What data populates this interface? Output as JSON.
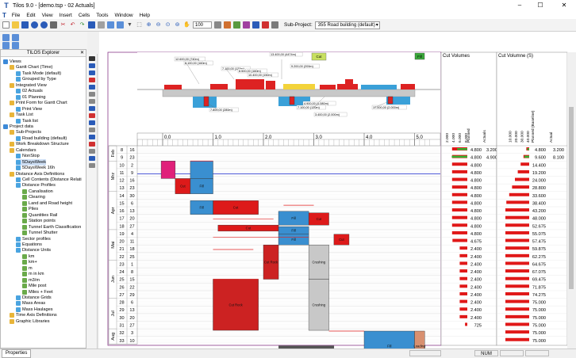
{
  "window": {
    "title": "Tilos 9.0  - [demo.tsp - 02 Actuals]",
    "min": "–",
    "max": "☐",
    "close": "✕"
  },
  "menu": {
    "file": "File",
    "edit": "Edit",
    "view": "View",
    "insert": "Insert",
    "cells": "Cells",
    "tools": "Tools",
    "window": "Window",
    "help": "Help"
  },
  "toolbar": {
    "zoom": "100",
    "subproject_label": "Sub-Project:",
    "subproject_value": "355 Road building (default)"
  },
  "explorer": {
    "title": "TILOS Explorer",
    "nodes": [
      {
        "label": "Views",
        "depth": 0
      },
      {
        "label": "Gantt Chart (Time)",
        "depth": 1
      },
      {
        "label": "Task Mode (default)",
        "depth": 2
      },
      {
        "label": "Grouped by Type",
        "depth": 2
      },
      {
        "label": "Integrated View",
        "depth": 1
      },
      {
        "label": "02 Actuals",
        "depth": 2
      },
      {
        "label": "01 Planning",
        "depth": 2
      },
      {
        "label": "Print Form for Gantt Chart",
        "depth": 1
      },
      {
        "label": "Print View",
        "depth": 2
      },
      {
        "label": "Task List",
        "depth": 1
      },
      {
        "label": "Task list",
        "depth": 2
      },
      {
        "label": "Project data",
        "depth": 0
      },
      {
        "label": "Sub-Projects",
        "depth": 1
      },
      {
        "label": "Road building (default)",
        "depth": 2
      },
      {
        "label": "Work Breakdown Structure",
        "depth": 1
      },
      {
        "label": "Calendars",
        "depth": 1
      },
      {
        "label": "NonStop",
        "depth": 2
      },
      {
        "label": "5DaysWeek",
        "depth": 2
      },
      {
        "label": "5DaysWeek 16h",
        "depth": 2
      },
      {
        "label": "Distance Axis Definitions",
        "depth": 1
      },
      {
        "label": "Cell Contents (Distance Relati",
        "depth": 2
      },
      {
        "label": "Distance Profiles",
        "depth": 2
      },
      {
        "label": "Canalisation",
        "depth": 3
      },
      {
        "label": "Clearing",
        "depth": 3
      },
      {
        "label": "Land and Road height",
        "depth": 3
      },
      {
        "label": "Piles",
        "depth": 3
      },
      {
        "label": "Quantities Rail",
        "depth": 3
      },
      {
        "label": "Station points",
        "depth": 3
      },
      {
        "label": "Tunnel Earth Classification",
        "depth": 3
      },
      {
        "label": "Tunnel Shutter",
        "depth": 3
      },
      {
        "label": "Sector profiles",
        "depth": 2
      },
      {
        "label": "Equations",
        "depth": 2
      },
      {
        "label": "Distance Units",
        "depth": 2
      },
      {
        "label": "km",
        "depth": 3
      },
      {
        "label": "km+",
        "depth": 3
      },
      {
        "label": "m",
        "depth": 3
      },
      {
        "label": "m in km",
        "depth": 3
      },
      {
        "label": "m3/m",
        "depth": 3
      },
      {
        "label": "Mile post",
        "depth": 3
      },
      {
        "label": "Miles + Feet",
        "depth": 3
      },
      {
        "label": "Distance Grids",
        "depth": 2
      },
      {
        "label": "Mass Areas",
        "depth": 2
      },
      {
        "label": "Mass Haulages",
        "depth": 2
      },
      {
        "label": "Time Axis Definitions",
        "depth": 1
      },
      {
        "label": "Graphic Libraries",
        "depth": 1
      }
    ]
  },
  "chart": {
    "distance_ticks": [
      "0.0",
      "1.0",
      "2.0",
      "3.0",
      "4.0",
      "5.0"
    ],
    "months": [
      {
        "label": "Feb",
        "row": 0,
        "span": 2
      },
      {
        "label": "Mrz",
        "row": 2,
        "span": 4
      },
      {
        "label": "Apr",
        "row": 6,
        "span": 5
      },
      {
        "label": "Mai",
        "row": 11,
        "span": 4
      },
      {
        "label": "Jun",
        "row": 15,
        "span": 5
      },
      {
        "label": "Jul",
        "row": 20,
        "span": 4
      },
      {
        "label": "Aug",
        "row": 24,
        "span": 2
      }
    ],
    "weeks": [
      {
        "w": "8",
        "d": "16"
      },
      {
        "w": "9",
        "d": "23"
      },
      {
        "w": "10",
        "d": "2"
      },
      {
        "w": "11",
        "d": "9"
      },
      {
        "w": "12",
        "d": "16"
      },
      {
        "w": "13",
        "d": "23"
      },
      {
        "w": "14",
        "d": "30"
      },
      {
        "w": "15",
        "d": "6"
      },
      {
        "w": "16",
        "d": "13"
      },
      {
        "w": "17",
        "d": "20"
      },
      {
        "w": "18",
        "d": "27"
      },
      {
        "w": "19",
        "d": "4"
      },
      {
        "w": "20",
        "d": "11"
      },
      {
        "w": "21",
        "d": "18"
      },
      {
        "w": "22",
        "d": "25"
      },
      {
        "w": "23",
        "d": "1"
      },
      {
        "w": "24",
        "d": "8"
      },
      {
        "w": "25",
        "d": "15"
      },
      {
        "w": "26",
        "d": "22"
      },
      {
        "w": "27",
        "d": "29"
      },
      {
        "w": "28",
        "d": "6"
      },
      {
        "w": "29",
        "d": "13"
      },
      {
        "w": "30",
        "d": "20"
      },
      {
        "w": "31",
        "d": "27"
      },
      {
        "w": "32",
        "d": "3"
      },
      {
        "w": "33",
        "d": "10"
      }
    ],
    "tasks": [
      {
        "label": "",
        "x0": -0.03,
        "x1": 0.25,
        "r0": 2.0,
        "r1": 4.3,
        "color": "#e0207a"
      },
      {
        "label": "",
        "x0": 0.55,
        "x1": 1.0,
        "r0": 2.0,
        "r1": 4.3,
        "color": "#3a8fd0"
      },
      {
        "label": "Cut",
        "x0": 0.25,
        "x1": 0.55,
        "r0": 4.3,
        "r1": 6.3,
        "color": "#dd1a1a"
      },
      {
        "label": "Fill",
        "x0": 0.55,
        "x1": 1.0,
        "r0": 4.3,
        "r1": 6.3,
        "color": "#3a8fd0"
      },
      {
        "label": "Cut",
        "x0": 1.0,
        "x1": 1.9,
        "r0": 7.2,
        "r1": 9.0,
        "color": "#dd1a1a"
      },
      {
        "label": "Fill",
        "x0": 0.55,
        "x1": 1.0,
        "r0": 7.2,
        "r1": 9.0,
        "color": "#3a8fd0"
      },
      {
        "label": "Fill",
        "x0": 2.3,
        "x1": 2.9,
        "r0": 8.6,
        "r1": 10.4,
        "color": "#3a8fd0"
      },
      {
        "label": "Cut",
        "x0": 2.9,
        "x1": 3.3,
        "r0": 8.8,
        "r1": 10.4,
        "color": "#dd1a1a"
      },
      {
        "label": "Cut",
        "x0": 1.1,
        "x1": 2.3,
        "r0": 10.4,
        "r1": 11.2,
        "color": "#dd1a1a"
      },
      {
        "label": "Fill",
        "x0": 2.3,
        "x1": 2.9,
        "r0": 10.6,
        "r1": 11.6,
        "color": "#3a8fd0"
      },
      {
        "label": "Fill",
        "x0": 2.3,
        "x1": 2.9,
        "r0": 11.6,
        "r1": 13.0,
        "color": "#3a8fd0"
      },
      {
        "label": "Cut",
        "x0": 3.4,
        "x1": 3.7,
        "r0": 11.6,
        "r1": 13.0,
        "color": "#dd1a1a"
      },
      {
        "label": "Cut Rock",
        "x0": 2.0,
        "x1": 2.3,
        "r0": 13.0,
        "r1": 17.5,
        "color": "#cc2222"
      },
      {
        "label": "Crushing",
        "x0": 2.9,
        "x1": 3.3,
        "r0": 13.0,
        "r1": 17.5,
        "color": "#c8c8c8"
      },
      {
        "label": "Cut Rock",
        "x0": 1.0,
        "x1": 1.9,
        "r0": 17.5,
        "r1": 24.2,
        "color": "#cc2222"
      },
      {
        "label": "Crushing",
        "x0": 2.9,
        "x1": 3.3,
        "r0": 17.5,
        "r1": 24.2,
        "color": "#c8c8c8"
      },
      {
        "label": "Fill",
        "x0": 4.0,
        "x1": 5.0,
        "r0": 24.3,
        "r1": 28.2,
        "color": "#3a8fd0"
      },
      {
        "label": "Loading",
        "x0": 5.0,
        "x1": 5.2,
        "r0": 24.3,
        "r1": 28.2,
        "color": "#d89070"
      }
    ],
    "long_section": {
      "blocks": [
        "#dd2222",
        "#f3d33a",
        "#3aa0d8",
        "#8cc83c"
      ],
      "labels": [
        "12.600,00 (740m)",
        "8.100,00 (160m)",
        "13.400,00 (4474m)",
        "7.100,00 (120m)",
        "8.500,00 (160m)",
        "10.400,00 (150m)",
        "9.200,00 (200m)",
        "7.800,00 (280m)",
        "3.400,00 (2.000m)",
        "4.900,00 (1.080m)",
        "7.100,00 (120m)",
        "17.000,00 (2.000m)"
      ],
      "callouts": [
        "Fill",
        "Cut"
      ]
    },
    "cut_volumes": {
      "header": "Cut Volumes",
      "axis": [
        "2.000",
        "4.000",
        "6.000",
        "8.000"
      ],
      "col_planned": "Planned",
      "col_actuals": "Actuals",
      "planned": [
        "4.800",
        "4.800",
        "4.800",
        "4.800",
        "4.800",
        "4.800",
        "4.800",
        "4.800",
        "4.800",
        "4.800",
        "4.800",
        "4.800",
        "4.675",
        "2.400",
        "2.400",
        "2.400",
        "2.400",
        "2.400",
        "2.400",
        "2.400",
        "2.400",
        "2.400",
        "2.400",
        "725",
        "",
        ""
      ],
      "actuals": [
        "3.200",
        "4.900",
        "",
        "",
        "",
        "",
        "",
        "",
        "",
        "",
        "",
        "",
        "",
        "",
        "",
        "",
        "",
        "",
        "",
        "",
        "",
        "",
        "",
        "",
        "",
        ""
      ]
    },
    "cut_volume_s": {
      "header": "Cut Volumne (S)",
      "axis": [
        "10.000",
        "20.000",
        "30.000",
        "40.000"
      ],
      "col_planned": "Planned (Baseline)",
      "col_actuals": "Actual",
      "planned": [
        "4.800",
        "9.600",
        "14.400",
        "19.200",
        "24.000",
        "28.800",
        "33.600",
        "38.400",
        "43.200",
        "48.000",
        "52.675",
        "55.075",
        "57.475",
        "59.875",
        "62.275",
        "64.675",
        "67.075",
        "69.475",
        "71.875",
        "74.275",
        "75.000",
        "75.000",
        "75.000",
        "75.000",
        "75.000",
        "75.000"
      ],
      "actuals": [
        "3.200",
        "8.100",
        "",
        "",
        "",
        "",
        "",
        "",
        "",
        "",
        "",
        "",
        "",
        "",
        "",
        "",
        "",
        "",
        "",
        "",
        "",
        "",
        "",
        "",
        "",
        ""
      ]
    }
  },
  "status": {
    "tab": "Properties",
    "num": "NUM"
  }
}
